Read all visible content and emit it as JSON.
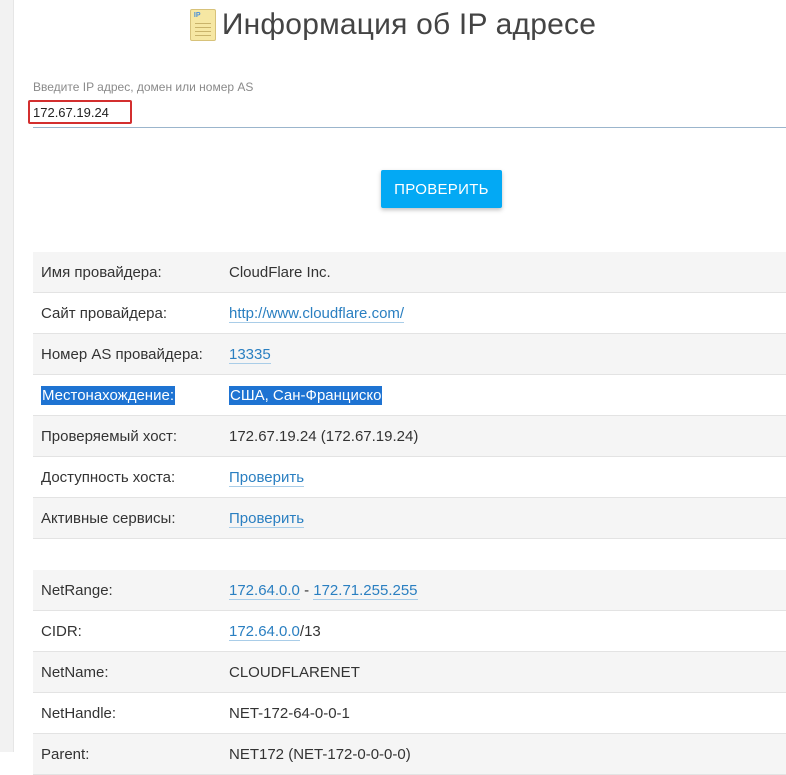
{
  "header": {
    "title": "Информация об IP адресе",
    "icon": "ip-document-icon"
  },
  "search": {
    "label": "Введите IP адрес, домен или номер AS",
    "value": "172.67.19.24"
  },
  "button": {
    "label": "ПРОВЕРИТЬ"
  },
  "provider_table": [
    {
      "key": "Имя провайдера:",
      "value": "CloudFlare Inc."
    },
    {
      "key": "Сайт провайдера:",
      "value": "http://www.cloudflare.com/"
    },
    {
      "key": "Номер AS провайдера:",
      "value": "13335"
    },
    {
      "key": "Местонахождение:",
      "value": "США, Сан-Франциско"
    },
    {
      "key": "Проверяемый хост:",
      "value": "172.67.19.24 (172.67.19.24)"
    },
    {
      "key": "Доступность хоста:",
      "value": "Проверить"
    },
    {
      "key": "Активные сервисы:",
      "value": "Проверить"
    }
  ],
  "net_table": [
    {
      "key": "NetRange:",
      "value_start": "172.64.0.0",
      "separator": " - ",
      "value_end": "172.71.255.255"
    },
    {
      "key": "CIDR:",
      "value": "172.64.0.0",
      "suffix": "/13"
    },
    {
      "key": "NetName:",
      "value": "CLOUDFLARENET"
    },
    {
      "key": "NetHandle:",
      "value": "NET-172-64-0-0-1"
    },
    {
      "key": "Parent:",
      "value": "NET172 (NET-172-0-0-0-0)"
    }
  ],
  "colors": {
    "accent": "#03a9f4",
    "link": "#2a7fc1",
    "selection": "#1e73d2",
    "highlight_border": "#d32f2f"
  }
}
